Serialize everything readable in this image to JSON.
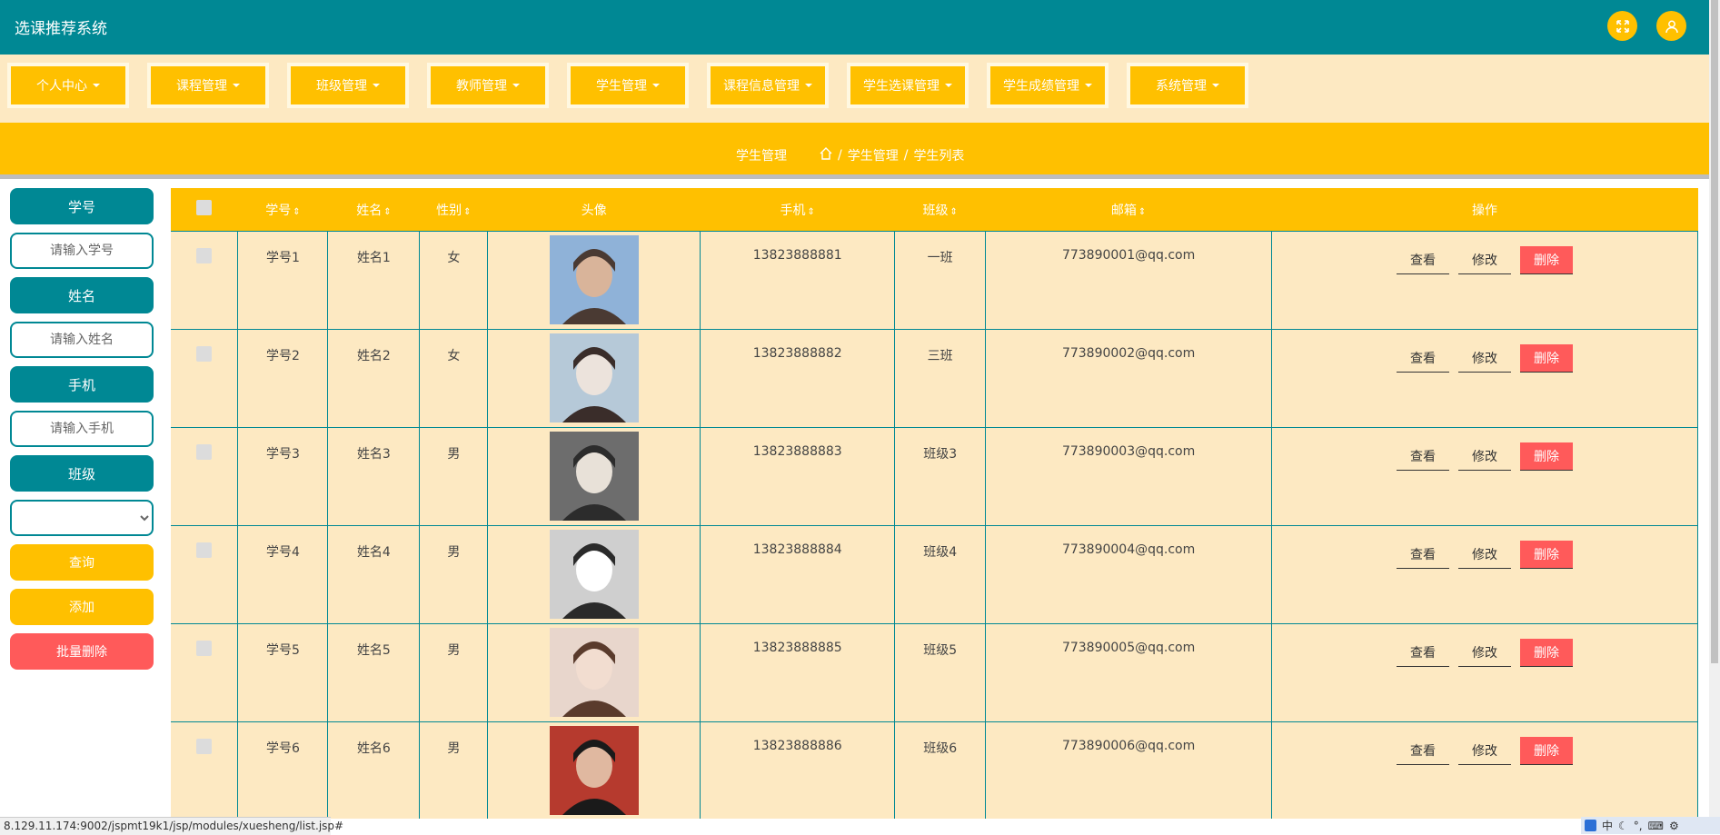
{
  "header": {
    "title": "选课推荐系统",
    "fullscreen_icon": "expand-icon",
    "user_icon": "user-icon"
  },
  "nav": [
    {
      "label": "个人中心"
    },
    {
      "label": "课程管理"
    },
    {
      "label": "班级管理"
    },
    {
      "label": "教师管理"
    },
    {
      "label": "学生管理"
    },
    {
      "label": "课程信息管理"
    },
    {
      "label": "学生选课管理"
    },
    {
      "label": "学生成绩管理"
    },
    {
      "label": "系统管理"
    }
  ],
  "breadcrumb": {
    "section": "学生管理",
    "home_icon": "home-icon",
    "sep": "/",
    "level1": "学生管理",
    "level2": "学生列表"
  },
  "sidebar": {
    "studentno_label": "学号",
    "studentno_placeholder": "请输入学号",
    "name_label": "姓名",
    "name_placeholder": "请输入姓名",
    "phone_label": "手机",
    "phone_placeholder": "请输入手机",
    "class_label": "班级",
    "class_selected": "",
    "search_button": "查询",
    "add_button": "添加",
    "batch_delete_button": "批量删除"
  },
  "table": {
    "headers": {
      "studentno": "学号",
      "name": "姓名",
      "gender": "性别",
      "avatar": "头像",
      "phone": "手机",
      "class": "班级",
      "email": "邮箱",
      "actions": "操作"
    },
    "sort_glyph": "⇕",
    "action_labels": {
      "view": "查看",
      "edit": "修改",
      "delete": "删除"
    },
    "rows": [
      {
        "studentno": "学号1",
        "name": "姓名1",
        "gender": "女",
        "phone": "13823888881",
        "class": "一班",
        "email": "773890001@qq.com"
      },
      {
        "studentno": "学号2",
        "name": "姓名2",
        "gender": "女",
        "phone": "13823888882",
        "class": "三班",
        "email": "773890002@qq.com"
      },
      {
        "studentno": "学号3",
        "name": "姓名3",
        "gender": "男",
        "phone": "13823888883",
        "class": "班级3",
        "email": "773890003@qq.com"
      },
      {
        "studentno": "学号4",
        "name": "姓名4",
        "gender": "男",
        "phone": "13823888884",
        "class": "班级4",
        "email": "773890004@qq.com"
      },
      {
        "studentno": "学号5",
        "name": "姓名5",
        "gender": "男",
        "phone": "13823888885",
        "class": "班级5",
        "email": "773890005@qq.com"
      },
      {
        "studentno": "学号6",
        "name": "姓名6",
        "gender": "男",
        "phone": "13823888886",
        "class": "班级6",
        "email": "773890006@qq.com"
      }
    ]
  },
  "statusbar": {
    "url": "8.129.11.174:9002/jspmt19k1/jsp/modules/xuesheng/list.jsp#"
  },
  "tray": {
    "ime_label": "中"
  },
  "colors": {
    "teal": "#008894",
    "yellow": "#ffc000",
    "cream": "#fde9c2",
    "red": "#ff5a5a"
  }
}
